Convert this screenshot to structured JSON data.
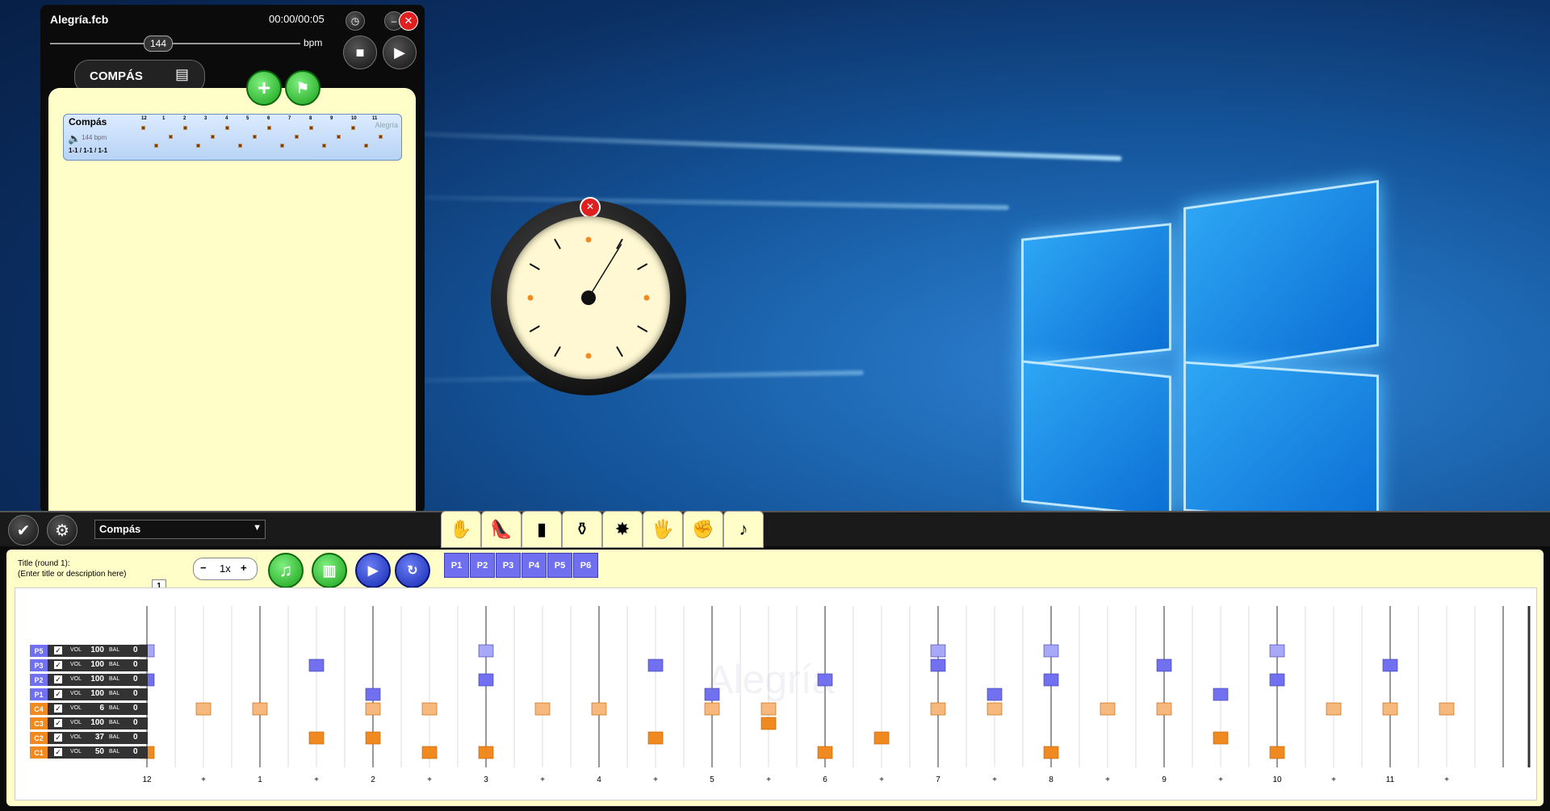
{
  "player": {
    "title": "Alegría.fcb",
    "time": "00:00/00:05",
    "tempo_value": "144",
    "tempo_unit": "bpm",
    "compas_label": "COMPÁS",
    "card": {
      "name": "Compás",
      "bpm": "144 bpm",
      "pattern": "1-1 / 1-1 / 1-1",
      "watermark": "Alegría",
      "beat_labels": [
        "12",
        "1",
        "2",
        "3",
        "4",
        "5",
        "6",
        "7",
        "8",
        "9",
        "10",
        "11"
      ]
    }
  },
  "editor": {
    "style_select": "Compás",
    "title_line1": "Title (round 1):",
    "title_line2": "(Enter title or description here)",
    "speed_minus": "−",
    "speed": "1x",
    "speed_plus": "+",
    "percussion_buttons": [
      "P1",
      "P2",
      "P3",
      "P4",
      "P5",
      "P6"
    ],
    "instrument_tabs": [
      "palmas-icon",
      "shoe-icon",
      "cajon-icon",
      "djembe-icon",
      "castanets-icon",
      "hands-icon",
      "knuckles-icon",
      "bongos-icon"
    ],
    "measure_tab": "1",
    "watermark": "Alegría",
    "vol_label": "VOL",
    "bal_label": "BAL",
    "tracks": [
      {
        "name": "P5",
        "vol": "100",
        "bal": "0",
        "kind": "palmas"
      },
      {
        "name": "P3",
        "vol": "100",
        "bal": "0",
        "kind": "palmas"
      },
      {
        "name": "P2",
        "vol": "100",
        "bal": "0",
        "kind": "palmas"
      },
      {
        "name": "P1",
        "vol": "100",
        "bal": "0",
        "kind": "palmas"
      },
      {
        "name": "C4",
        "vol": "6",
        "bal": "0",
        "kind": "cajon"
      },
      {
        "name": "C3",
        "vol": "100",
        "bal": "0",
        "kind": "cajon"
      },
      {
        "name": "C2",
        "vol": "37",
        "bal": "0",
        "kind": "cajon"
      },
      {
        "name": "C1",
        "vol": "50",
        "bal": "0",
        "kind": "cajon"
      }
    ],
    "beat_axis": [
      "12",
      "+",
      "1",
      "+",
      "2",
      "+",
      "3",
      "+",
      "4",
      "+",
      "5",
      "+",
      "6",
      "+",
      "7",
      "+",
      "8",
      "+",
      "9",
      "+",
      "10",
      "+",
      "11",
      "+"
    ],
    "notes": {
      "P5": [
        0,
        6,
        14,
        16,
        20
      ],
      "P3": [
        3,
        9,
        14,
        18,
        22
      ],
      "P2": [
        0,
        6,
        12,
        16,
        20
      ],
      "P1": [
        4,
        10,
        15,
        19
      ],
      "C4": [
        1,
        2,
        4,
        5,
        7,
        8,
        10,
        11,
        14,
        15,
        17,
        18,
        21,
        22,
        23
      ],
      "C3": [
        11
      ],
      "C2": [
        3,
        4,
        9,
        13,
        19
      ],
      "C1": [
        0,
        5,
        6,
        12,
        16,
        20
      ]
    },
    "colors": {
      "palmas": "#7070f0",
      "palmas_light": "#a8a8f8",
      "cajon": "#f6b87c",
      "cajon_dark": "#f08a20"
    }
  }
}
